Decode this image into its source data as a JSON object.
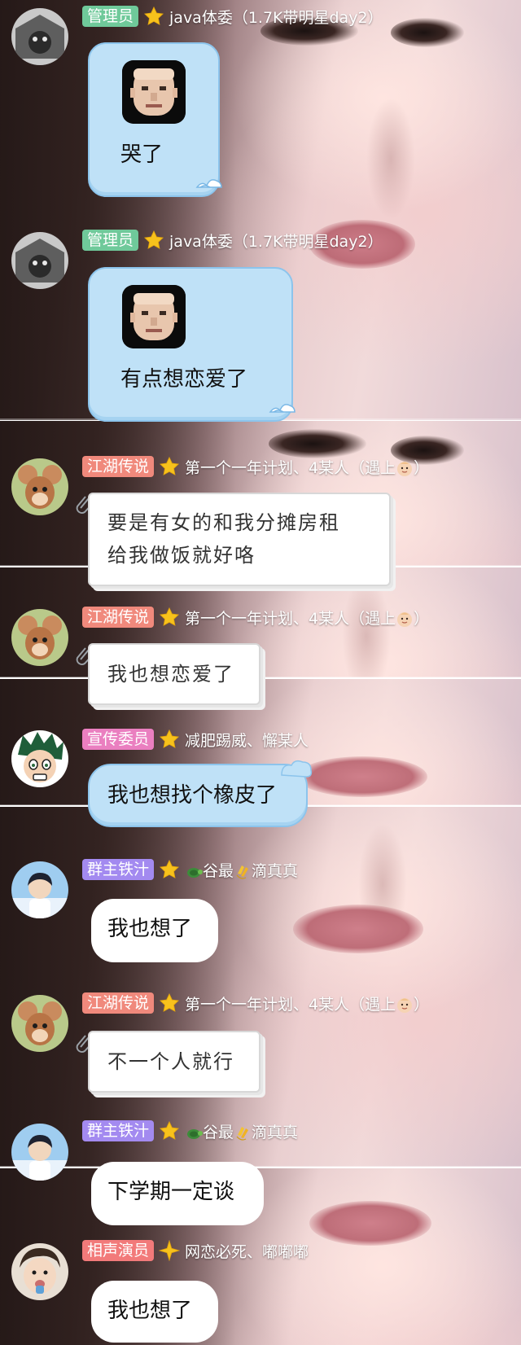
{
  "colors": {
    "badge_admin": "#6fc99a",
    "badge_jianghu": "#f0897c",
    "badge_xuanchuan": "#ea7fc0",
    "badge_qunzhu": "#a38af0",
    "badge_xiangsheng": "#f27a7a",
    "star": "#f7c21c",
    "bubble_blue": "#bfe1f7",
    "bubble_white": "#ffffff"
  },
  "messages": [
    {
      "badge": "管理员",
      "nickname": "java体委（1.7K带明星day2）",
      "text": "哭了",
      "sticker": "old-man-face-icon",
      "style": "blue"
    },
    {
      "badge": "管理员",
      "nickname": "java体委（1.7K带明星day2）",
      "text": "有点想恋爱了",
      "sticker": "old-man-face-icon",
      "style": "blue"
    },
    {
      "badge": "江湖传说",
      "nickname": "第一个一年计划、4某人（遇上",
      "nickname_end": "）",
      "text_line1": "要是有女的和我分摊房租",
      "text_line2": "给我做饭就好咯",
      "style": "paper"
    },
    {
      "badge": "江湖传说",
      "nickname": "第一个一年计划、4某人（遇上",
      "nickname_end": "）",
      "text": "我也想恋爱了",
      "style": "paper"
    },
    {
      "badge": "宣传委员",
      "nickname": "减肥踢威、懈某人",
      "text": "我也想找个橡皮了",
      "style": "blue"
    },
    {
      "badge": "群主铁汁",
      "nickname": "谷最",
      "nickname_end": "滴真真",
      "text": "我也想了",
      "style": "white"
    },
    {
      "badge": "江湖传说",
      "nickname": "第一个一年计划、4某人（遇上",
      "nickname_end": "）",
      "text": "不一个人就行",
      "style": "paper"
    },
    {
      "badge": "群主铁汁",
      "nickname": "谷最",
      "nickname_end": "滴真真",
      "text": "下学期一定谈",
      "style": "white"
    },
    {
      "badge": "相声演员",
      "nickname": "网恋必死、嘟嘟嘟",
      "text": "我也想了",
      "style": "white"
    }
  ]
}
